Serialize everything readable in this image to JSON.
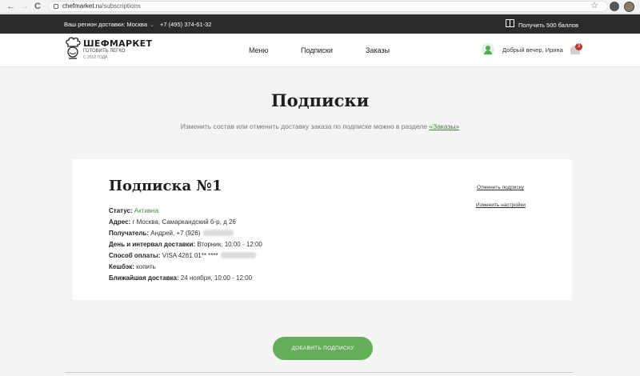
{
  "browser": {
    "back": "←",
    "forward": "→",
    "reload": "C",
    "url_host": "chefmarket.ru",
    "url_path": "/subscriptions",
    "star": "☆"
  },
  "topbar": {
    "region_label": "Ваш регион доставки: Москва",
    "phone": "+7 (495) 374-61-32",
    "bonus_text": "Получить 500 баллов"
  },
  "header": {
    "logo_name": "ШЕФМАРКЕТ",
    "logo_tagline": "ГОТОВИТЬ ЛЕГКО",
    "logo_since": "С 2012 ГОДА",
    "nav": [
      "Меню",
      "Подписки",
      "Заказы"
    ],
    "greeting": "Добрый вечер, Ирина",
    "notifications_count": "3"
  },
  "page": {
    "title": "Подписки",
    "subtitle_prefix": "Изменить состав или отменить доставку заказа по подписке можно в разделе ",
    "subtitle_link": "«Заказы»"
  },
  "subscription": {
    "title": "Подписка №1",
    "status_label": "Статус:",
    "status_value": "Активна",
    "address_label": "Адрес:",
    "address_value": "г Москва, Самаркандский б-р, д 26",
    "recipient_label": "Получатель:",
    "recipient_value": "Андрей, +7 (926)",
    "delivery_label": "День и интервал доставки:",
    "delivery_value": "Вторник, 10:00 - 12:00",
    "payment_label": "Способ оплаты:",
    "payment_value": "VISA 4261 01** ****",
    "cashback_label": "Кешбэк:",
    "cashback_value": "копить",
    "next_label": "Ближайшая доставка:",
    "next_value": "24 ноября, 10:00 - 12:00",
    "cancel_link": "Отменить подписку",
    "settings_link": "Изменить настройки"
  },
  "actions": {
    "add_subscription": "ДОБАВИТЬ ПОДПИСКУ"
  },
  "colors": {
    "accent_green": "#65ad5a",
    "topbar_bg": "#2b2b2b",
    "page_bg": "#f4f4f2"
  }
}
